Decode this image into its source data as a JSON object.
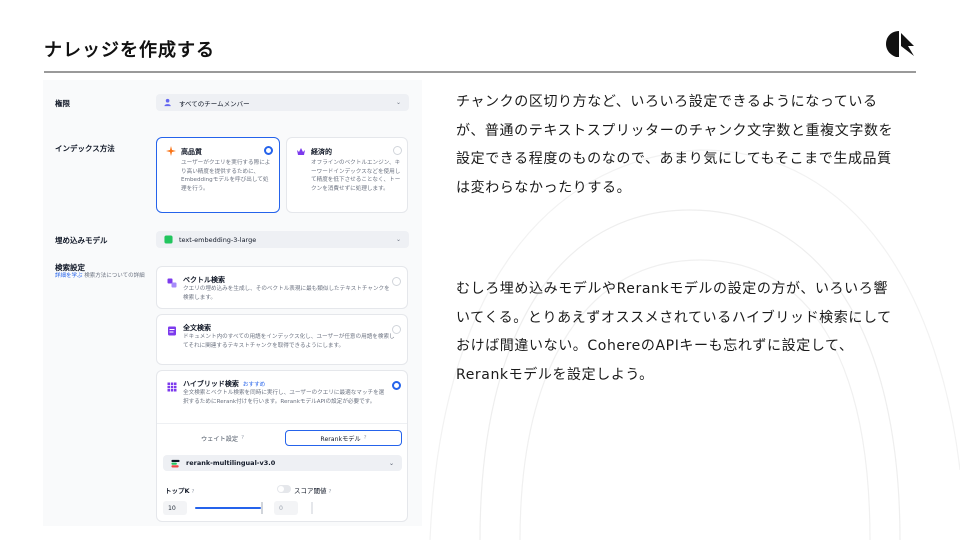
{
  "slide": {
    "title": "ナレッジを作成する",
    "paragraph_1": "チャンクの区切り方など、いろいろ設定できるようになっているが、普通のテキストスプリッターのチャンク文字数と重複文字数を設定できる程度のものなので、あまり気にしてもそこまで生成品質は変わらなかったりする。",
    "paragraph_2": "むしろ埋め込みモデルやRerankモデルの設定の方が、いろいろ響いてくる。とりあえずオススメされているハイブリッド検索にしておけば間違いない。CohereのAPIキーも忘れずに設定して、Rerankモデルを設定しよう。"
  },
  "form": {
    "permission": {
      "label": "権限",
      "value": "すべてのチームメンバー"
    },
    "index_method": {
      "label": "インデックス方法",
      "options": [
        {
          "title": "高品質",
          "description": "ユーザーがクエリを実行する際により高い精度を提供するために、Embeddingモデルを呼び出して処理を行う。",
          "selected": true
        },
        {
          "title": "経済的",
          "description": "オフラインのベクトルエンジン、キーワードインデックスなどを使用して精度を低下させることなく、トークンを消費せずに処理します。",
          "selected": false
        }
      ]
    },
    "embedding_model": {
      "label": "埋め込みモデル",
      "value": "text-embedding-3-large"
    },
    "retrieval": {
      "label": "検索設定",
      "link_text": "詳細を学ぶ",
      "link_suffix": " 検索方法についての詳細",
      "options": [
        {
          "title": "ベクトル検索",
          "description": "クエリの埋め込みを生成し、そのベクトル表現に最も類似したテキストチャンクを検索します。",
          "selected": false
        },
        {
          "title": "全文検索",
          "description": "ドキュメント内のすべての用語をインデックス化し、ユーザーが任意の用語を検索してそれに関連するテキストチャンクを取得できるようにします。",
          "selected": false
        },
        {
          "title": "ハイブリッド検索",
          "badge": "おすすめ",
          "description": "全文検索とベクトル検索を同時に実行し、ユーザーのクエリに最適なマッチを選択するためにRerank付けを行います。RerankモデルAPIの設定が必要です。",
          "selected": true
        }
      ],
      "tabs": [
        "ウェイト設定",
        "Rerankモデル"
      ],
      "help_glyph": "?",
      "rerank_model": "rerank-multilingual-v3.0",
      "top_k": {
        "label": "トップK",
        "value": "10",
        "fill": 0.97
      },
      "score_threshold": {
        "label": "スコア閾値",
        "value": "0",
        "enabled": false
      }
    },
    "chevron": "⌄"
  },
  "colors": {
    "accent": "#2563eb",
    "slide_rule": "#9a9a9a",
    "panel_bg": "#f9fafb",
    "icon_orange": "#f97316",
    "icon_purple": "#7c3aed",
    "icon_green": "#22c55e"
  },
  "icons": [
    "user-group-icon",
    "sparkle-icon",
    "piggy-bank-icon",
    "model-icon",
    "vector-search-icon",
    "fulltext-search-icon",
    "hybrid-search-icon",
    "rerank-model-icon",
    "chevron-down-icon",
    "help-icon",
    "logo-icon"
  ]
}
